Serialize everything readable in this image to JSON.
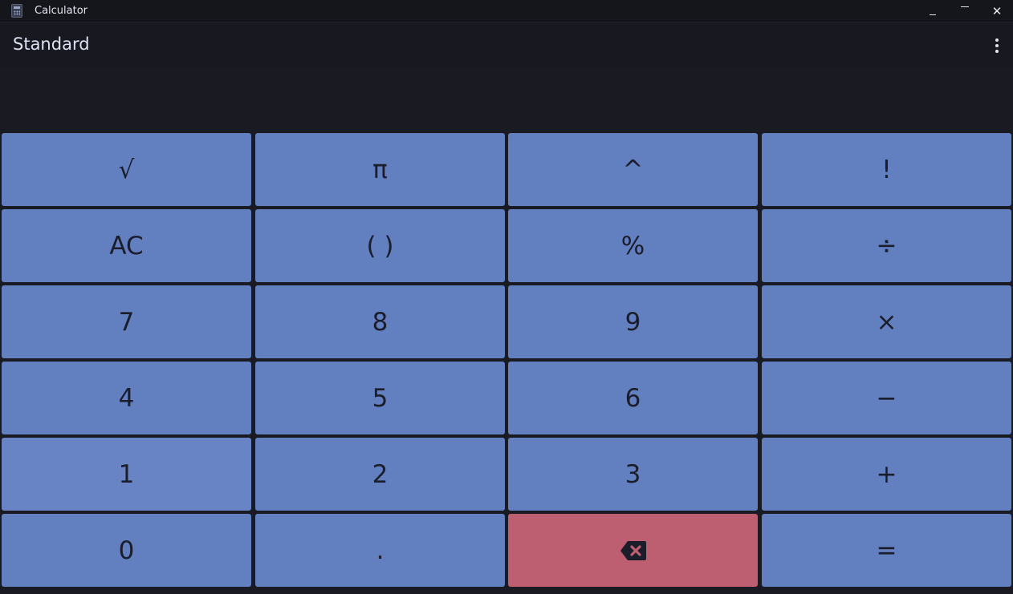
{
  "window": {
    "title": "Calculator",
    "icon": "calculator-icon",
    "minimize_icon": "minimize-icon",
    "maximize_icon": "maximize-icon",
    "close_label": "✕"
  },
  "header": {
    "mode": "Standard",
    "menu_icon": "more-vertical-icon"
  },
  "display": {
    "expression": "",
    "result": ""
  },
  "colors": {
    "background": "#1a1b22",
    "key": "#627fc0",
    "backspace_key": "#bd5f70",
    "key_text": "#1b1d2a"
  },
  "keys": [
    [
      "√",
      "π",
      "^",
      "!"
    ],
    [
      "AC",
      "( )",
      "%",
      "÷"
    ],
    [
      "7",
      "8",
      "9",
      "×"
    ],
    [
      "4",
      "5",
      "6",
      "−"
    ],
    [
      "1",
      "2",
      "3",
      "+"
    ],
    [
      "0",
      ".",
      "backspace-icon",
      "="
    ]
  ]
}
